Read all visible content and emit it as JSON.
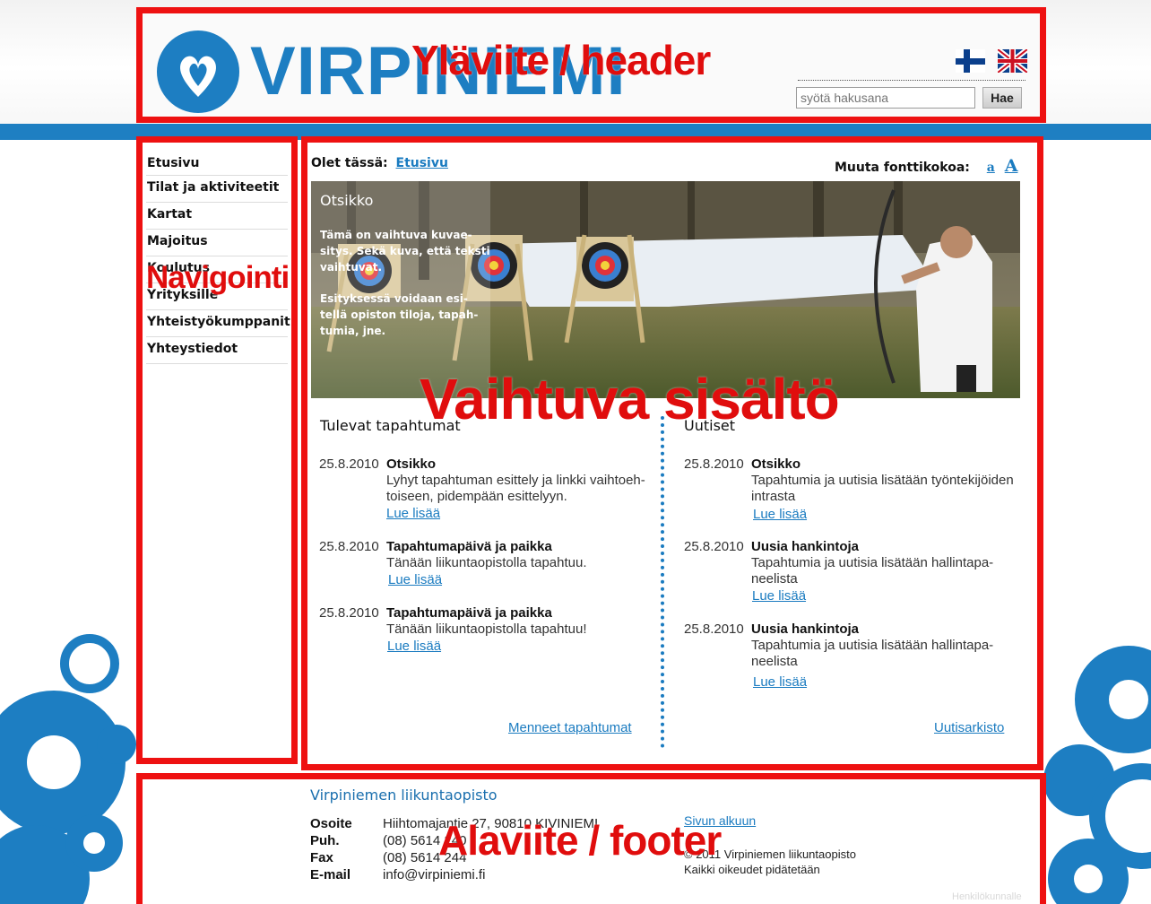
{
  "brand": {
    "logo_text": "VIRPINIEMI"
  },
  "header": {
    "search_placeholder": "syötä hakusana",
    "search_button": "Hae",
    "languages": [
      "fi",
      "en"
    ]
  },
  "annotations": {
    "header": "Yläviite / header",
    "nav": "Navigointi",
    "content": "Vaihtuva sisältö",
    "footer": "Alaviite / footer"
  },
  "nav": {
    "items": [
      {
        "label": "Etusivu"
      },
      {
        "label": "Tilat ja aktiviteetit"
      },
      {
        "label": "Kartat"
      },
      {
        "label": "Majoitus"
      },
      {
        "label": "Koulutus"
      },
      {
        "label": "Yrityksille"
      },
      {
        "label": "Yhteistyökumppanit"
      },
      {
        "label": "Yhteystiedot"
      }
    ]
  },
  "breadcrumb": {
    "prefix": "Olet tässä:",
    "current": "Etusivu"
  },
  "font_size": {
    "label": "Muuta fonttikokoa:",
    "small": "a",
    "large": "A"
  },
  "hero": {
    "title": "Otsikko",
    "paragraph1": "Tämä on vaihtuva kuvae-sitys. Sekä kuva, että teksti vaihtuvat.",
    "paragraph2": "Esityksessä voidaan esi-tellä opiston tiloja, tapah-tumia, jne."
  },
  "events": {
    "title": "Tulevat tapahtumat",
    "items": [
      {
        "date": "25.8.2010",
        "title": "Otsikko",
        "text": "Lyhyt tapahtuman esittely ja linkki vaihtoeh-toiseen, pidempään esittelyyn.",
        "link": "Lue lisää"
      },
      {
        "date": "25.8.2010",
        "title": "Tapahtumapäivä ja paikka",
        "text": "Tänään liikuntaopistolla tapahtuu.",
        "link": "Lue lisää"
      },
      {
        "date": "25.8.2010",
        "title": "Tapahtumapäivä ja paikka",
        "text": "Tänään liikuntaopistolla tapahtuu!",
        "link": "Lue lisää"
      }
    ],
    "archive_link": "Menneet tapahtumat"
  },
  "news": {
    "title": "Uutiset",
    "items": [
      {
        "date": "25.8.2010",
        "title": "Otsikko",
        "text": "Tapahtumia ja uutisia lisätään työntekijöiden intrasta",
        "link": "Lue lisää"
      },
      {
        "date": "25.8.2010",
        "title": "Uusia hankintoja",
        "text": "Tapahtumia ja uutisia lisätään hallintapa-neelista",
        "link": "Lue lisää"
      },
      {
        "date": "25.8.2010",
        "title": "Uusia hankintoja",
        "text": "Tapahtumia ja uutisia lisätään hallintapa-neelista",
        "link": "Lue lisää"
      }
    ],
    "archive_link": "Uutisarkisto"
  },
  "footer": {
    "org_name": "Virpiniemen liikuntaopisto",
    "contacts": [
      {
        "label": "Osoite",
        "value": "Hiihtomajantie 27, 90810 KIVINIEMI"
      },
      {
        "label": "Puh.",
        "value": "(08) 5614 240"
      },
      {
        "label": "Fax",
        "value": "(08) 5614 244"
      },
      {
        "label": "E-mail",
        "value": "info@virpiniemi.fi"
      }
    ],
    "top_link": "Sivun alkuun",
    "copyright": "© 2011 Virpiniemen liikuntaopisto",
    "rights": "Kaikki oikeudet pidätetään",
    "staff_link": "Henkilökunnalle"
  },
  "colors": {
    "brand_blue": "#1d7ec2",
    "annotation_red": "#ee1111",
    "link_blue": "#1a7bc0"
  }
}
